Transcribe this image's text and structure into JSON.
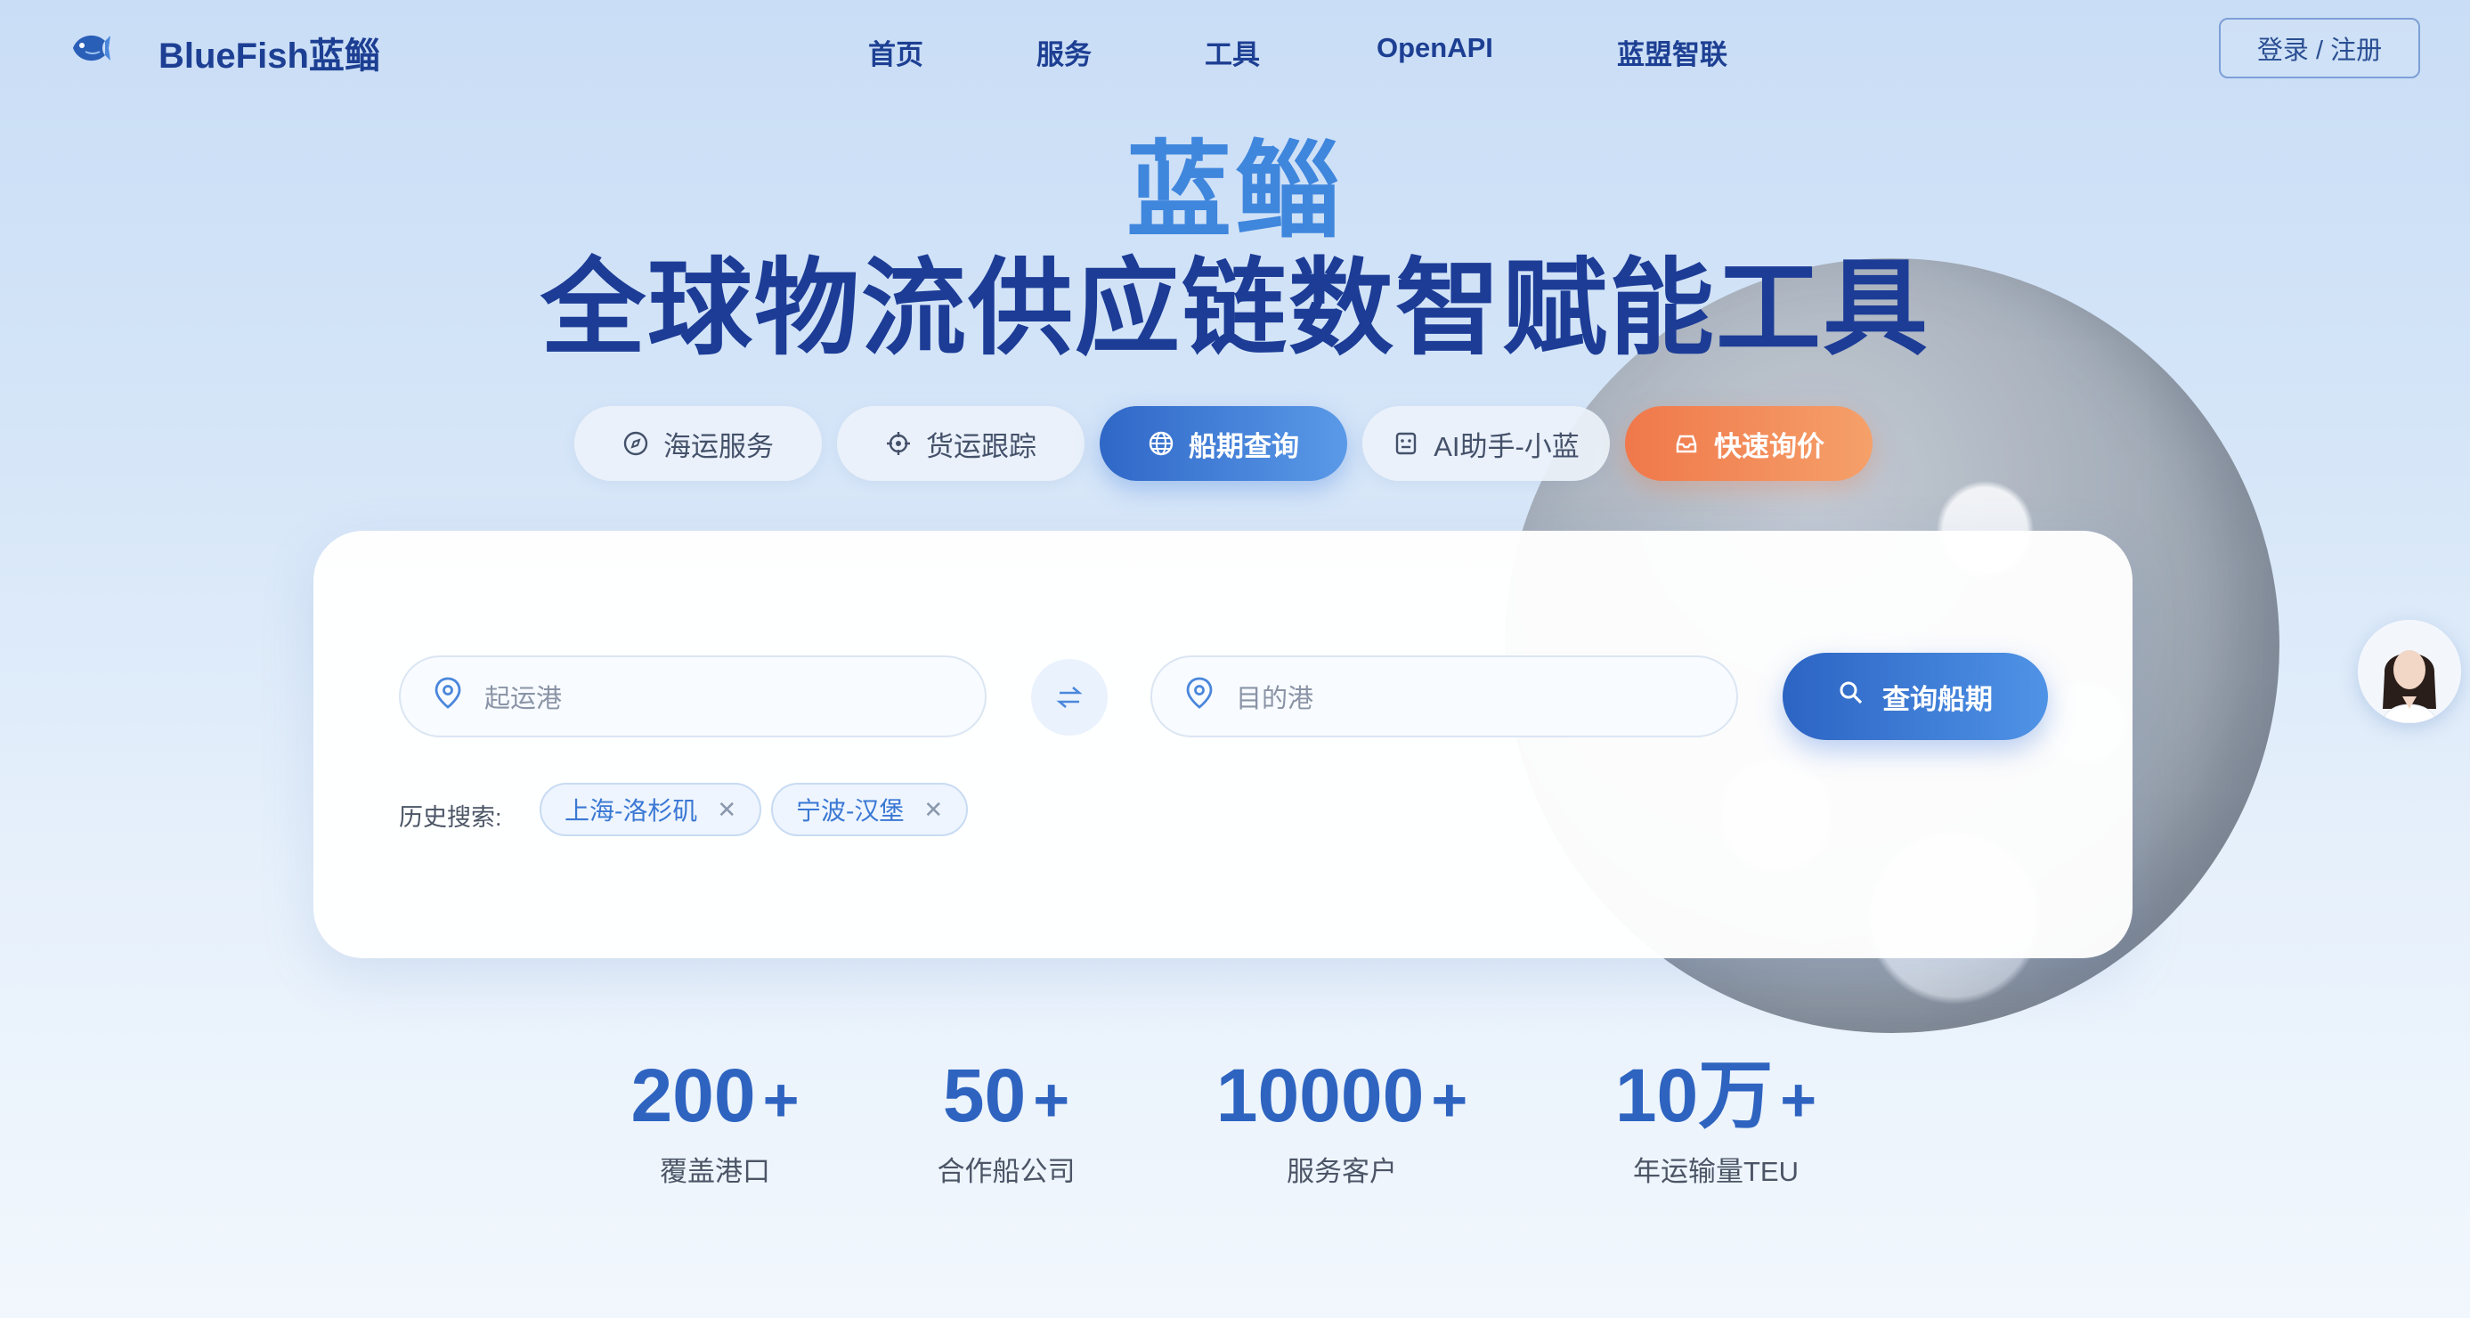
{
  "nav": {
    "brand": "BlueFish蓝鲻",
    "items": [
      "首页",
      "服务",
      "工具",
      "OpenAPI",
      "蓝盟智联"
    ],
    "login": "登录 / 注册"
  },
  "hero": {
    "subtitle": "蓝鲻",
    "title": "全球物流供应链数智赋能工具"
  },
  "tabs": [
    {
      "label": "海运服务",
      "icon": "compass-icon"
    },
    {
      "label": "货运跟踪",
      "icon": "crosshair-icon"
    },
    {
      "label": "船期查询",
      "icon": "globe-icon",
      "active": true
    },
    {
      "label": "AI助手-小蓝",
      "icon": "robot-icon"
    },
    {
      "label": "快速询价",
      "icon": "inbox-icon",
      "accent": "#f0784a"
    }
  ],
  "search": {
    "origin_placeholder": "起运港",
    "destination_placeholder": "目的港",
    "button": "查询船期",
    "history_label": "历史搜索:",
    "history": [
      "上海-洛杉矶",
      "宁波-汉堡"
    ]
  },
  "stats": [
    {
      "value": "200",
      "suffix": "+",
      "label": "覆盖港口"
    },
    {
      "value": "50",
      "suffix": "+",
      "label": "合作船公司"
    },
    {
      "value": "10000",
      "suffix": "+",
      "label": "服务客户"
    },
    {
      "value": "10万",
      "suffix": "+",
      "label": "年运输量TEU"
    }
  ],
  "colors": {
    "primary": "#2e64c0",
    "accent_orange": "#f0784a",
    "title_dark": "#1c3c96"
  }
}
